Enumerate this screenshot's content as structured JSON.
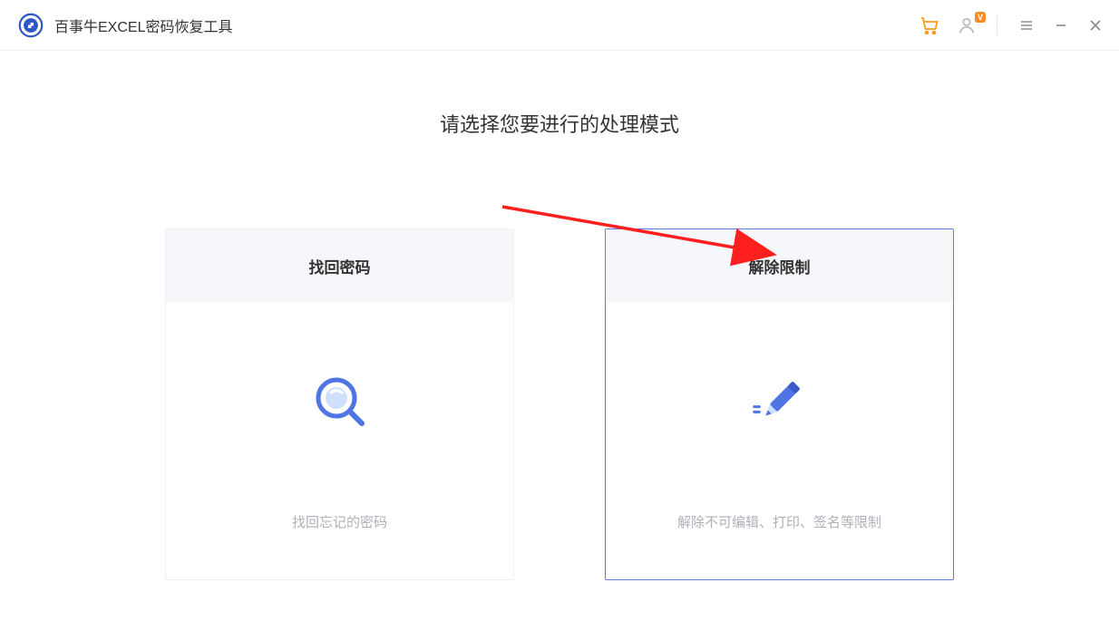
{
  "app": {
    "title": "百事牛EXCEL密码恢复工具"
  },
  "titlebar": {
    "vip_badge": "V",
    "icons": {
      "cart": "cart-icon",
      "user": "user-icon",
      "menu": "menu-icon",
      "minimize": "minimize-icon",
      "close": "close-icon"
    }
  },
  "main": {
    "prompt": "请选择您要进行的处理模式",
    "cards": [
      {
        "id": "recover",
        "title": "找回密码",
        "desc": "找回忘记的密码",
        "icon": "magnifier-icon",
        "selected": false
      },
      {
        "id": "unlock",
        "title": "解除限制",
        "desc": "解除不可编辑、打印、签名等限制",
        "icon": "pencil-icon",
        "selected": true
      }
    ]
  },
  "colors": {
    "accent": "#5a7be0",
    "cart": "#ff9a1f",
    "arrow": "#ff1f1f"
  }
}
